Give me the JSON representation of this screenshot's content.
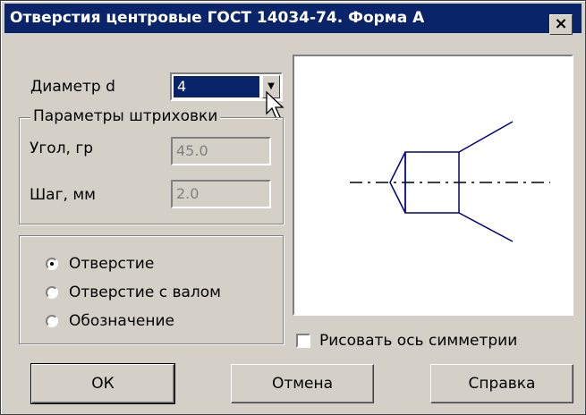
{
  "window": {
    "title": "Отверстия центровые ГОСТ 14034-74. Форма А",
    "close_label": "×"
  },
  "diameter": {
    "label": "Диаметр d",
    "selected": "4"
  },
  "hatching": {
    "legend": "Параметры штриховки",
    "angle_label": "Угол, гр",
    "angle_value": "45.0",
    "step_label": "Шаг, мм",
    "step_value": "2.0"
  },
  "mode": {
    "options": [
      "Отверстие",
      "Отверстие с валом",
      "Обозначение"
    ],
    "selected_index": 0
  },
  "axis_checkbox": {
    "label": "Рисовать ось симметрии",
    "checked": false
  },
  "buttons": {
    "ok": "ОК",
    "cancel": "Отмена",
    "help": "Справка"
  },
  "colors": {
    "title_bar": "#0a246a",
    "drawing": "#000080",
    "face": "#d4d0c8"
  }
}
